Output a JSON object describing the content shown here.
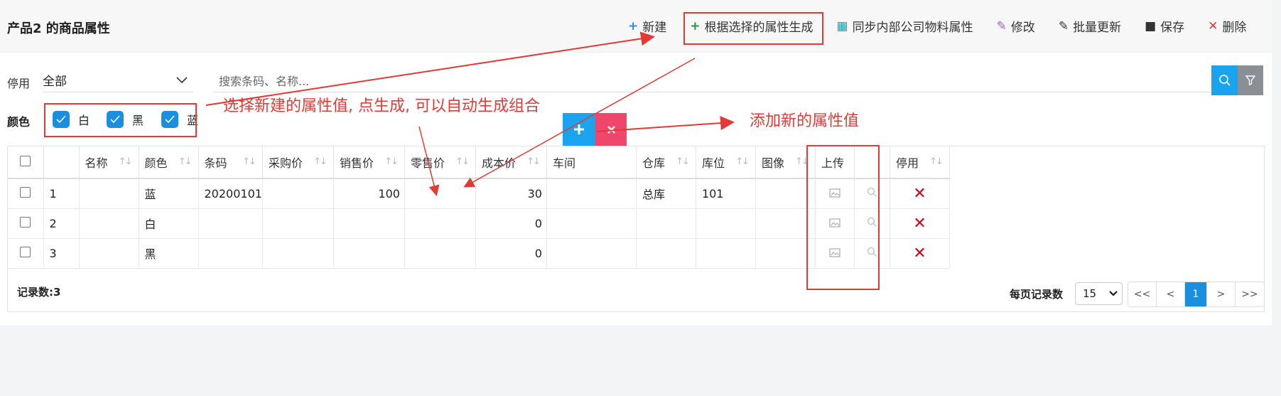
{
  "header": {
    "title": "产品2 的商品属性",
    "toolbar": [
      {
        "icon": "+",
        "label": "新建",
        "color": "#2d8cf0"
      },
      {
        "icon": "+",
        "label": "根据选择的属性生成",
        "color": "#1a9a3c"
      },
      {
        "icon": "▦",
        "label": "同步内部公司物料属性",
        "color": "#17a2b8"
      },
      {
        "icon": "✎",
        "label": "修改",
        "color": "#a05fc6"
      },
      {
        "icon": "✎",
        "label": "批量更新",
        "color": "#333333"
      },
      {
        "icon": "■",
        "label": "保存",
        "color": "#333333"
      },
      {
        "icon": "✕",
        "label": "删除",
        "color": "#e53935"
      }
    ]
  },
  "filter": {
    "label": "停用",
    "select_value": "全部",
    "search_placeholder": "搜索条码、名称..."
  },
  "colors": {
    "label": "颜色",
    "options": [
      "白",
      "黑",
      "蓝"
    ]
  },
  "annotations": {
    "generate_hint": "选择新建的属性值, 点生成, 可以自动生成组合",
    "add_hint": "添加新的属性值"
  },
  "table": {
    "columns": [
      "",
      "",
      "名称",
      "颜色",
      "条码",
      "采购价",
      "销售价",
      "零售价",
      "成本价",
      "车间",
      "仓库",
      "库位",
      "图像",
      "上传",
      "",
      "停用"
    ],
    "rows": [
      {
        "no": "1",
        "name": "",
        "color": "蓝",
        "barcode": "20200101",
        "purchase": "",
        "sale": "100",
        "retail": "",
        "cost": "30",
        "workshop": "",
        "warehouse": "总库",
        "location": "101",
        "image": ""
      },
      {
        "no": "2",
        "name": "",
        "color": "白",
        "barcode": "",
        "purchase": "",
        "sale": "",
        "retail": "",
        "cost": "0",
        "workshop": "",
        "warehouse": "",
        "location": "",
        "image": ""
      },
      {
        "no": "3",
        "name": "",
        "color": "黑",
        "barcode": "",
        "purchase": "",
        "sale": "",
        "retail": "",
        "cost": "0",
        "workshop": "",
        "warehouse": "",
        "location": "",
        "image": ""
      }
    ]
  },
  "footer": {
    "count": "记录数:3",
    "per_page_label": "每页记录数",
    "per_page": "15",
    "pages": [
      "<<",
      "<",
      "1",
      ">",
      ">>"
    ],
    "current_page": "1"
  }
}
